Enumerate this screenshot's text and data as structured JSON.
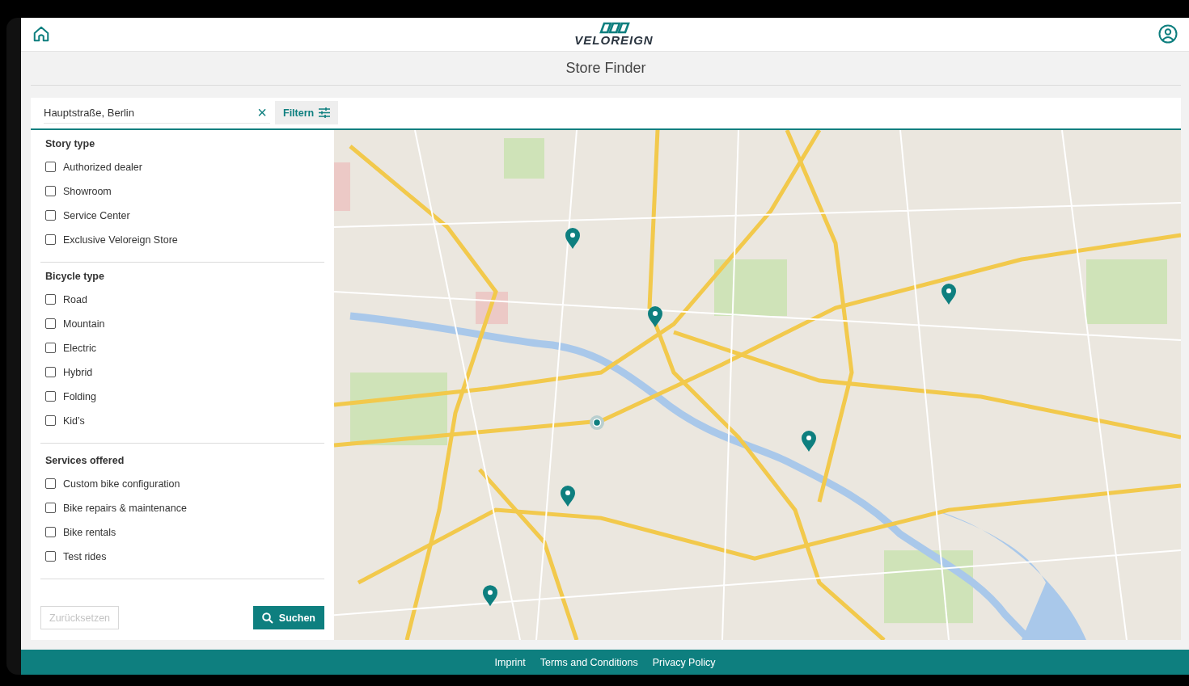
{
  "header": {
    "brand": "VELOREIGN"
  },
  "title": "Store Finder",
  "search": {
    "value": "Hauptstraße, Berlin",
    "clear": "×",
    "filter_button": "Filtern"
  },
  "filters": [
    {
      "heading": "Story type",
      "options": [
        {
          "label": "Authorized dealer",
          "checked": false
        },
        {
          "label": "Showroom",
          "checked": false
        },
        {
          "label": "Service Center",
          "checked": false
        },
        {
          "label": "Exclusive Veloreign Store",
          "checked": false
        }
      ]
    },
    {
      "heading": "Bicycle type",
      "options": [
        {
          "label": "Road",
          "checked": false
        },
        {
          "label": "Mountain",
          "checked": false
        },
        {
          "label": "Electric",
          "checked": false
        },
        {
          "label": "Hybrid",
          "checked": false
        },
        {
          "label": "Folding",
          "checked": false
        },
        {
          "label": "Kid’s",
          "checked": false
        }
      ]
    },
    {
      "heading": "Services offered",
      "options": [
        {
          "label": "Custom bike configuration",
          "checked": false
        },
        {
          "label": "Bike repairs & maintenance",
          "checked": false
        },
        {
          "label": "Bike rentals",
          "checked": false
        },
        {
          "label": "Test rides",
          "checked": false
        }
      ]
    }
  ],
  "buttons": [
    {
      "label": "Zurücksetzen",
      "kind": "reset",
      "disabled": true
    },
    {
      "label": "Suchen",
      "kind": "search",
      "disabled": false
    }
  ],
  "footer": {
    "links": [
      "Imprint",
      "Terms and Conditions",
      "Privacy Policy"
    ]
  }
}
